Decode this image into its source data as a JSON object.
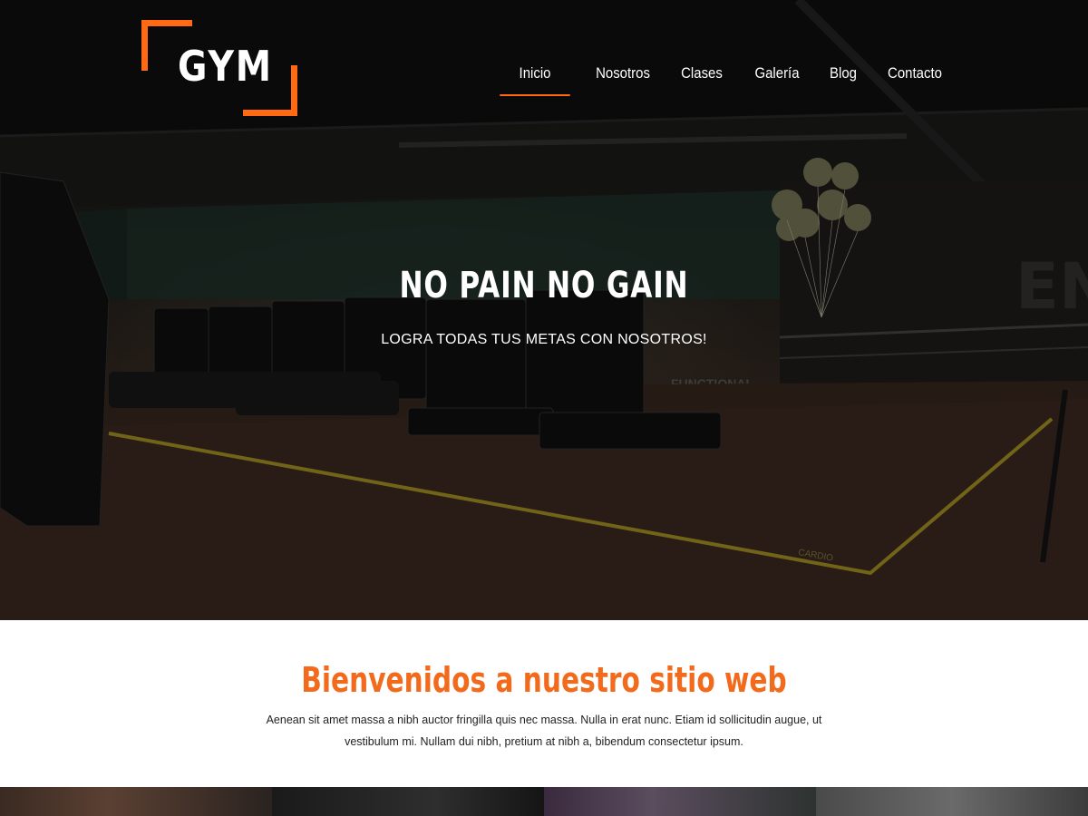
{
  "brand": {
    "logo_text": "GYM",
    "accent_color": "#ff6a13"
  },
  "nav": {
    "items": [
      {
        "label": "Inicio",
        "active": true
      },
      {
        "label": "Nosotros",
        "active": false
      },
      {
        "label": "Clases",
        "active": false
      },
      {
        "label": "Galería",
        "active": false
      },
      {
        "label": "Blog",
        "active": false
      },
      {
        "label": "Contacto",
        "active": false
      }
    ]
  },
  "hero": {
    "title": "NO PAIN NO GAIN",
    "subtitle": "LOGRA TODAS TUS METAS CON NOSOTROS!",
    "background": "gym-interior-photo",
    "scene_text": {
      "floor_marking": "CARDIO",
      "wall_sign": "FUNCTIONAL"
    }
  },
  "welcome": {
    "title": "Bienvenidos a nuestro sitio web",
    "title_color": "#f26a1b",
    "text": "Aenean sit amet massa a nibh auctor fringilla quis nec massa. Nulla in erat nunc. Etiam id sollicitudin augue, ut vestibulum mi. Nullam dui nibh, pretium at nibh a, bibendum consectetur ipsum."
  },
  "gallery_strip": {
    "tiles": [
      "gallery-photo-1",
      "gallery-photo-2",
      "gallery-photo-3",
      "gallery-photo-4"
    ]
  }
}
